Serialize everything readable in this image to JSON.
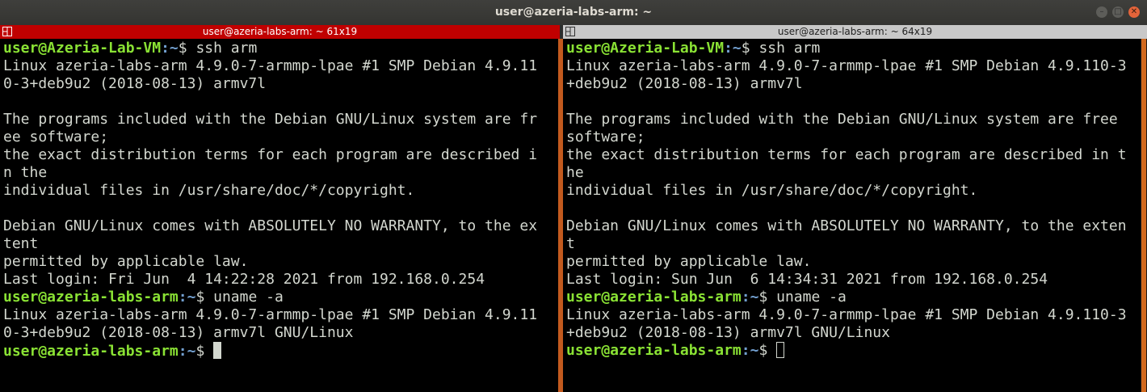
{
  "window": {
    "title": "user@azeria-labs-arm: ~"
  },
  "panes": {
    "left": {
      "header": "user@azeria-labs-arm: ~ 61x19",
      "lines": [
        {
          "user": "user@Azeria-Lab-VM",
          "path": ":~",
          "cmd": "$ ssh arm"
        },
        {
          "text": "Linux azeria-labs-arm 4.9.0-7-armmp-lpae #1 SMP Debian 4.9.11"
        },
        {
          "text": "0-3+deb9u2 (2018-08-13) armv7l"
        },
        {
          "text": ""
        },
        {
          "text": "The programs included with the Debian GNU/Linux system are fr"
        },
        {
          "text": "ee software;"
        },
        {
          "text": "the exact distribution terms for each program are described i"
        },
        {
          "text": "n the"
        },
        {
          "text": "individual files in /usr/share/doc/*/copyright."
        },
        {
          "text": ""
        },
        {
          "text": "Debian GNU/Linux comes with ABSOLUTELY NO WARRANTY, to the ex"
        },
        {
          "text": "tent"
        },
        {
          "text": "permitted by applicable law."
        },
        {
          "text": "Last login: Fri Jun  4 14:22:28 2021 from 192.168.0.254"
        },
        {
          "user": "user@azeria-labs-arm",
          "path": ":~",
          "cmd": "$ uname -a"
        },
        {
          "text": "Linux azeria-labs-arm 4.9.0-7-armmp-lpae #1 SMP Debian 4.9.11"
        },
        {
          "text": "0-3+deb9u2 (2018-08-13) armv7l GNU/Linux"
        },
        {
          "user": "user@azeria-labs-arm",
          "path": ":~",
          "cmd": "$",
          "cursor": "block"
        }
      ]
    },
    "right": {
      "header": "user@azeria-labs-arm: ~ 64x19",
      "lines": [
        {
          "user": "user@Azeria-Lab-VM",
          "path": ":~",
          "cmd": "$ ssh arm"
        },
        {
          "text": "Linux azeria-labs-arm 4.9.0-7-armmp-lpae #1 SMP Debian 4.9.110-3"
        },
        {
          "text": "+deb9u2 (2018-08-13) armv7l"
        },
        {
          "text": ""
        },
        {
          "text": "The programs included with the Debian GNU/Linux system are free"
        },
        {
          "text": "software;"
        },
        {
          "text": "the exact distribution terms for each program are described in t"
        },
        {
          "text": "he"
        },
        {
          "text": "individual files in /usr/share/doc/*/copyright."
        },
        {
          "text": ""
        },
        {
          "text": "Debian GNU/Linux comes with ABSOLUTELY NO WARRANTY, to the exten"
        },
        {
          "text": "t"
        },
        {
          "text": "permitted by applicable law."
        },
        {
          "text": "Last login: Sun Jun  6 14:34:31 2021 from 192.168.0.254"
        },
        {
          "user": "user@azeria-labs-arm",
          "path": ":~",
          "cmd": "$ uname -a"
        },
        {
          "text": "Linux azeria-labs-arm 4.9.0-7-armmp-lpae #1 SMP Debian 4.9.110-3"
        },
        {
          "text": "+deb9u2 (2018-08-13) armv7l GNU/Linux"
        },
        {
          "user": "user@azeria-labs-arm",
          "path": ":~",
          "cmd": "$",
          "cursor": "hollow"
        }
      ]
    }
  },
  "colors": {
    "active_header": "#c00000",
    "inactive_header": "#c8c8c8",
    "prompt_user": "#8ae234",
    "prompt_path": "#729fcf",
    "terminal_fg": "#d3d7cf",
    "divider": "#c25a1e"
  },
  "icons": {
    "close": "close-icon",
    "minimize": "minimize-icon",
    "maximize": "maximize-icon",
    "split": "split-pane-icon"
  }
}
